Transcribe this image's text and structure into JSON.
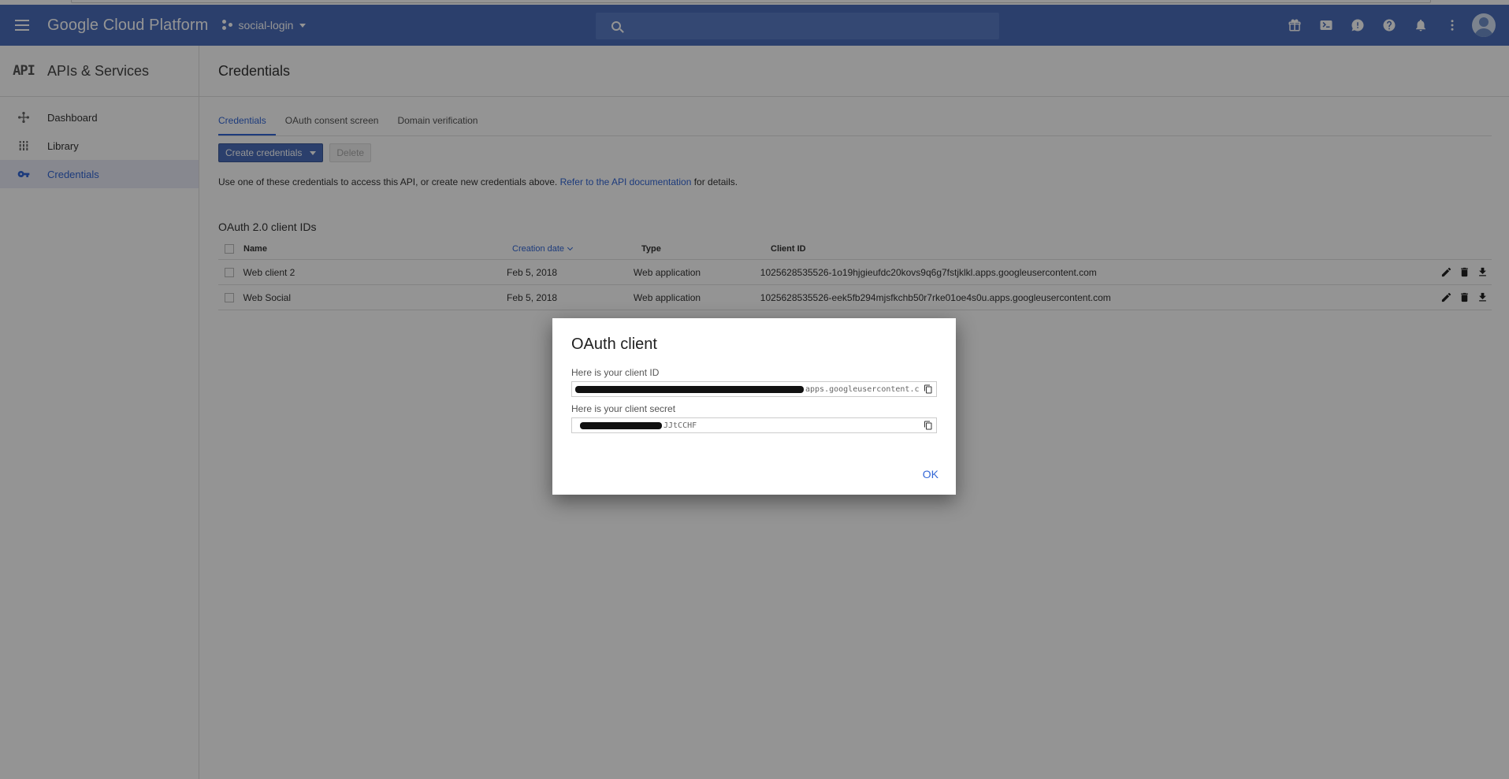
{
  "topbar": {
    "brand": "Google Cloud Platform",
    "project": "social-login",
    "search_placeholder": ""
  },
  "sidebar": {
    "logo": "API",
    "title": "APIs & Services",
    "items": [
      {
        "label": "Dashboard",
        "icon": "dashboard-icon"
      },
      {
        "label": "Library",
        "icon": "library-icon"
      },
      {
        "label": "Credentials",
        "icon": "key-icon",
        "active": true
      }
    ]
  },
  "page": {
    "title": "Credentials",
    "tabs": [
      "Credentials",
      "OAuth consent screen",
      "Domain verification"
    ],
    "create_button": "Create credentials",
    "delete_button": "Delete",
    "info_text": "Use one of these credentials to access this API, or create new credentials above.",
    "info_link": "Refer to the API documentation",
    "info_suffix": "for details.",
    "section_title": "OAuth 2.0 client IDs"
  },
  "table": {
    "headers": {
      "name": "Name",
      "date": "Creation date",
      "type": "Type",
      "client_id": "Client ID"
    },
    "rows": [
      {
        "name": "Web client 2",
        "date": "Feb 5, 2018",
        "type": "Web application",
        "client_id": "1025628535526-1o19hjgieufdc20kovs9q6g7fstjklkl.apps.googleusercontent.com"
      },
      {
        "name": "Web Social",
        "date": "Feb 5, 2018",
        "type": "Web application",
        "client_id": "1025628535526-eek5fb294mjsfkchb50r7rke01oe4s0u.apps.googleusercontent.com"
      }
    ]
  },
  "dialog": {
    "title": "OAuth client",
    "client_id_label": "Here is your client ID",
    "client_id_visible": "apps.googleusercontent.c",
    "client_secret_label": "Here is your client secret",
    "client_secret_visible": "JJtCCHF",
    "ok": "OK"
  }
}
